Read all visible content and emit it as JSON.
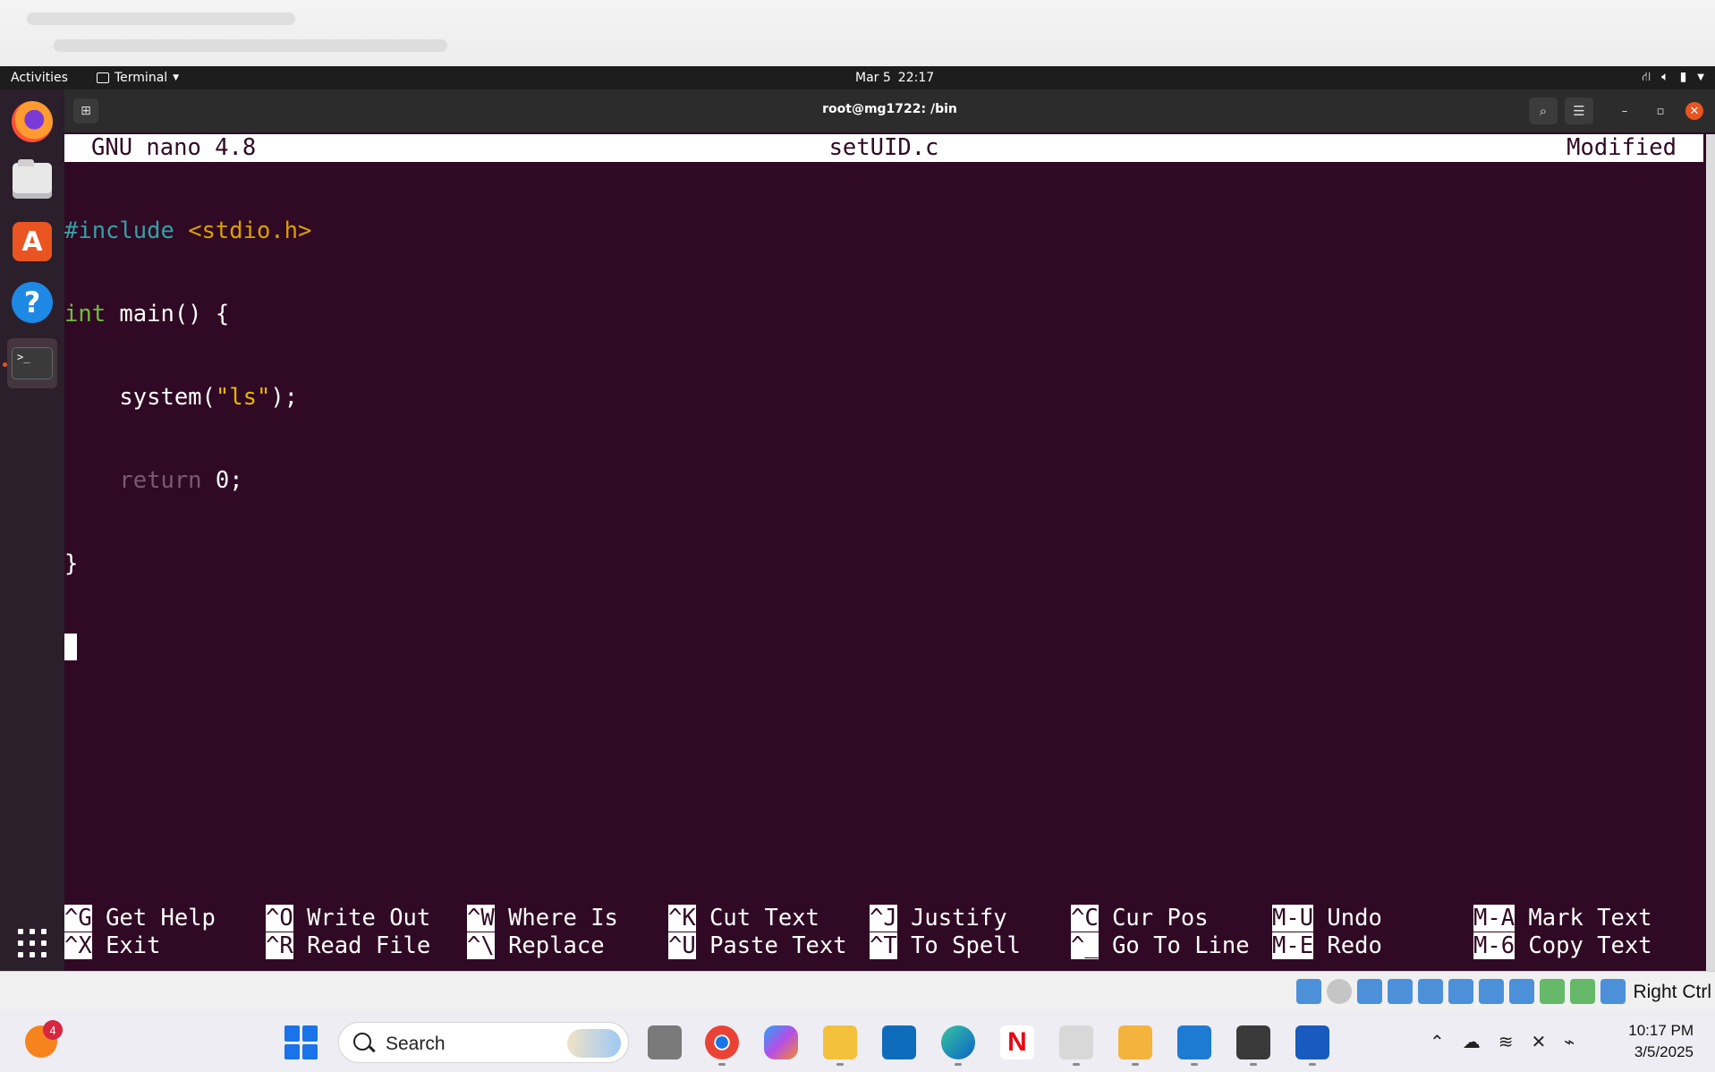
{
  "ubuntu_topbar": {
    "activities": "Activities",
    "app_menu": "Terminal",
    "date": "Mar 5",
    "time": "22:17"
  },
  "terminal": {
    "title": "root@mg1722: /bin"
  },
  "nano": {
    "version": "GNU nano 4.8",
    "filename": "setUID.c",
    "status": "Modified",
    "code": {
      "include_kw": "#include",
      "include_hdr": "<stdio.h>",
      "type_kw": "int",
      "main_sig": " main() {",
      "call_pre": "    system(",
      "call_str": "\"ls\"",
      "call_post": ");",
      "return_indent": "    ",
      "return_kw": "return",
      "return_val": " 0;",
      "close_brace": "}"
    },
    "shortcuts": [
      {
        "key": "^G",
        "label": "Get Help"
      },
      {
        "key": "^O",
        "label": "Write Out"
      },
      {
        "key": "^W",
        "label": "Where Is"
      },
      {
        "key": "^K",
        "label": "Cut Text"
      },
      {
        "key": "^J",
        "label": "Justify"
      },
      {
        "key": "^C",
        "label": "Cur Pos"
      },
      {
        "key": "M-U",
        "label": "Undo"
      },
      {
        "key": "M-A",
        "label": "Mark Text"
      },
      {
        "key": "^X",
        "label": "Exit"
      },
      {
        "key": "^R",
        "label": "Read File"
      },
      {
        "key": "^\\",
        "label": "Replace"
      },
      {
        "key": "^U",
        "label": "Paste Text"
      },
      {
        "key": "^T",
        "label": "To Spell"
      },
      {
        "key": "^_",
        "label": "Go To Line"
      },
      {
        "key": "M-E",
        "label": "Redo"
      },
      {
        "key": "M-6",
        "label": "Copy Text"
      }
    ]
  },
  "vbox": {
    "host_key": "Right Ctrl"
  },
  "taskbar": {
    "notification_count": "4",
    "search_placeholder": "Search",
    "time": "10:17 PM",
    "date": "3/5/2025"
  },
  "colors": {
    "terminal_bg": "#300a24",
    "accent": "#e95420"
  }
}
